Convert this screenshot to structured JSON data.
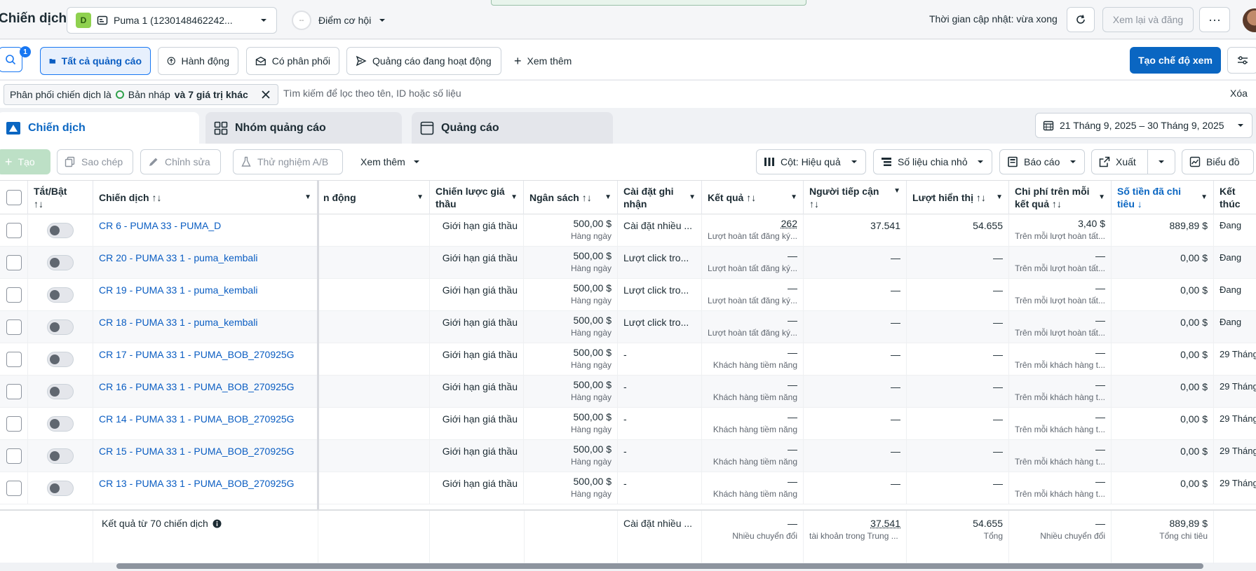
{
  "header": {
    "page_title": "Chiến dịch",
    "account_badge": "D",
    "account_name": "Puma 1 (1230148462242...",
    "opportunity_label": "Điểm cơ hội",
    "opportunity_icon": "--",
    "update_time": "Thời gian cập nhật: vừa xong",
    "review_button": "Xem lại và đăng",
    "more_button": "···"
  },
  "filters": {
    "search_badge": "1",
    "tabs": [
      {
        "label": "Tất cả quảng cáo"
      },
      {
        "label": "Hành động"
      },
      {
        "label": "Có phân phối"
      },
      {
        "label": "Quảng cáo đang hoạt động"
      },
      {
        "label": "Xem thêm"
      }
    ],
    "create_view": "Tạo chế độ xem",
    "chip_prefix": "Phân phối chiến dịch là",
    "chip_value": "Bản nháp",
    "chip_more": "và 7 giá trị khác",
    "search_placeholder": "Tìm kiếm để lọc theo tên, ID hoặc số liệu",
    "clear": "Xóa"
  },
  "level_tabs": [
    {
      "label": "Chiến dịch"
    },
    {
      "label": "Nhóm quảng cáo"
    },
    {
      "label": "Quảng cáo"
    }
  ],
  "date_range": "21 Tháng 9, 2025 – 30 Tháng 9, 2025",
  "toolbar": {
    "create": "Tạo",
    "duplicate": "Sao chép",
    "edit": "Chỉnh sửa",
    "ab_test": "Thử nghiệm A/B",
    "more": "Xem thêm",
    "columns": "Cột: Hiệu quả",
    "breakdown": "Số liệu chia nhỏ",
    "reports": "Báo cáo",
    "export": "Xuất",
    "charts": "Biểu đồ"
  },
  "table": {
    "headers": {
      "toggle": "Tắt/Bật",
      "toggle_sort": "↑↓",
      "campaign": "Chiến dịch ↑↓",
      "delivery": "n động",
      "bid_strategy": "Chiến lược giá thầu",
      "budget": "Ngân sách ↑↓",
      "attribution": "Cài đặt ghi nhận",
      "results": "Kết quả ↑↓",
      "reach": "Người tiếp cận",
      "reach_sort": "↑↓",
      "impressions": "Lượt hiển thị ↑↓",
      "cost_per_result": "Chi phí trên mỗi kết quả ↑↓",
      "amount_spent": "Số tiền đã chi tiêu ↓",
      "ends": "Kết thúc"
    },
    "rows": [
      {
        "name": "CR 6 - PUMA 33 - PUMA_D",
        "bid": "Giới hạn giá thầu",
        "budget": "500,00 $",
        "budget_sub": "Hàng ngày",
        "attribution": "Cài đặt nhiều ...",
        "result": "262",
        "result_sub": "Lượt hoàn tất đăng ký...",
        "reach": "37.541",
        "impressions": "54.655",
        "cpr": "3,40 $",
        "cpr_sub": "Trên mỗi lượt hoàn tất...",
        "spent": "889,89 $",
        "ends": "Đang"
      },
      {
        "name": "CR 20 - PUMA 33 1 - puma_kembali",
        "bid": "Giới hạn giá thầu",
        "budget": "500,00 $",
        "budget_sub": "Hàng ngày",
        "attribution": "Lượt click tro...",
        "result": "—",
        "result_sub": "Lượt hoàn tất đăng ký...",
        "reach": "—",
        "impressions": "—",
        "cpr": "—",
        "cpr_sub": "Trên mỗi lượt hoàn tất...",
        "spent": "0,00 $",
        "ends": "Đang"
      },
      {
        "name": "CR 19 - PUMA 33 1 - puma_kembali",
        "bid": "Giới hạn giá thầu",
        "budget": "500,00 $",
        "budget_sub": "Hàng ngày",
        "attribution": "Lượt click tro...",
        "result": "—",
        "result_sub": "Lượt hoàn tất đăng ký...",
        "reach": "—",
        "impressions": "—",
        "cpr": "—",
        "cpr_sub": "Trên mỗi lượt hoàn tất...",
        "spent": "0,00 $",
        "ends": "Đang"
      },
      {
        "name": "CR 18 - PUMA 33 1 - puma_kembali",
        "bid": "Giới hạn giá thầu",
        "budget": "500,00 $",
        "budget_sub": "Hàng ngày",
        "attribution": "Lượt click tro...",
        "result": "—",
        "result_sub": "Lượt hoàn tất đăng ký...",
        "reach": "—",
        "impressions": "—",
        "cpr": "—",
        "cpr_sub": "Trên mỗi lượt hoàn tất...",
        "spent": "0,00 $",
        "ends": "Đang"
      },
      {
        "name": "CR 17 - PUMA 33 1 - PUMA_BOB_270925G",
        "bid": "Giới hạn giá thầu",
        "budget": "500,00 $",
        "budget_sub": "Hàng ngày",
        "attribution": "-",
        "result": "—",
        "result_sub": "Khách hàng tiềm năng",
        "reach": "—",
        "impressions": "—",
        "cpr": "—",
        "cpr_sub": "Trên mỗi khách hàng t...",
        "spent": "0,00 $",
        "ends": "29 Tháng"
      },
      {
        "name": "CR 16 - PUMA 33 1 - PUMA_BOB_270925G",
        "bid": "Giới hạn giá thầu",
        "budget": "500,00 $",
        "budget_sub": "Hàng ngày",
        "attribution": "-",
        "result": "—",
        "result_sub": "Khách hàng tiềm năng",
        "reach": "—",
        "impressions": "—",
        "cpr": "—",
        "cpr_sub": "Trên mỗi khách hàng t...",
        "spent": "0,00 $",
        "ends": "29 Tháng"
      },
      {
        "name": "CR 14 - PUMA 33 1 - PUMA_BOB_270925G",
        "bid": "Giới hạn giá thầu",
        "budget": "500,00 $",
        "budget_sub": "Hàng ngày",
        "attribution": "-",
        "result": "—",
        "result_sub": "Khách hàng tiềm năng",
        "reach": "—",
        "impressions": "—",
        "cpr": "—",
        "cpr_sub": "Trên mỗi khách hàng t...",
        "spent": "0,00 $",
        "ends": "29 Tháng"
      },
      {
        "name": "CR 15 - PUMA 33 1 - PUMA_BOB_270925G",
        "bid": "Giới hạn giá thầu",
        "budget": "500,00 $",
        "budget_sub": "Hàng ngày",
        "attribution": "-",
        "result": "—",
        "result_sub": "Khách hàng tiềm năng",
        "reach": "—",
        "impressions": "—",
        "cpr": "—",
        "cpr_sub": "Trên mỗi khách hàng t...",
        "spent": "0,00 $",
        "ends": "29 Tháng"
      },
      {
        "name": "CR 13 - PUMA 33 1 - PUMA_BOB_270925G",
        "bid": "Giới hạn giá thầu",
        "budget": "500,00 $",
        "budget_sub": "Hàng ngày",
        "attribution": "-",
        "result": "—",
        "result_sub": "Khách hàng tiềm năng",
        "reach": "—",
        "impressions": "—",
        "cpr": "—",
        "cpr_sub": "Trên mỗi khách hàng t...",
        "spent": "0,00 $",
        "ends": "29 Tháng"
      }
    ],
    "summary": {
      "label": "Kết quả từ 70 chiến dịch",
      "attribution": "Cài đặt nhiều ...",
      "result": "—",
      "result_sub": "Nhiều chuyển đổi",
      "reach": "37.541",
      "reach_sub": "tài khoản trong Trung ...",
      "impressions": "54.655",
      "impressions_sub": "Tổng",
      "cpr": "—",
      "cpr_sub": "Nhiều chuyển đổi",
      "spent": "889,89 $",
      "spent_sub": "Tổng chi tiêu"
    }
  },
  "colors": {
    "primary": "#0a66c2",
    "link": "#0a5dc2",
    "draft": "#31a24c"
  }
}
